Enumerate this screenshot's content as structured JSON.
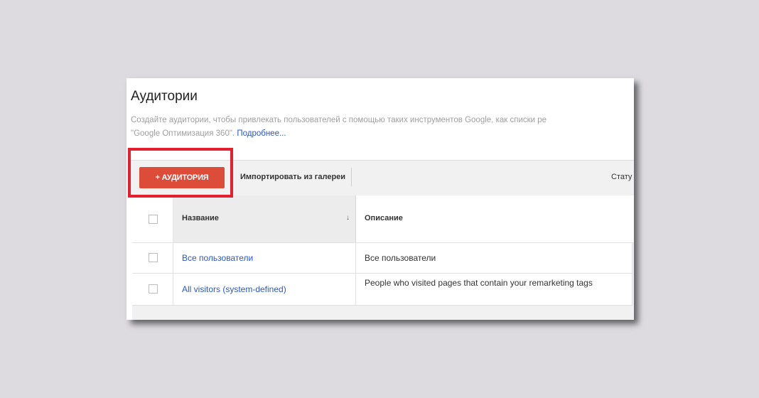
{
  "page": {
    "title": "Аудитории",
    "description_line1": "Создайте аудитории, чтобы привлекать пользователей с помощью таких инструментов Google, как списки ре",
    "description_line2_prefix": "\"Google Оптимизация 360\".",
    "description_link": "Подробнее..."
  },
  "toolbar": {
    "add_audience_label": "+ АУДИТОРИЯ",
    "import_label": "Импортировать из галереи",
    "status_label": "Стату"
  },
  "table": {
    "columns": {
      "name": "Название",
      "description": "Описание"
    },
    "sort_icon": "↓",
    "rows": [
      {
        "name": "Все пользователи",
        "description": "Все пользователи"
      },
      {
        "name": "All visitors (system-defined)",
        "description": "People who visited pages that contain your remarketing tags"
      }
    ]
  },
  "colors": {
    "accent_button": "#dd4b39",
    "link": "#2a56c6",
    "highlight_frame": "#e5202e",
    "backdrop": "#dddbe0"
  }
}
